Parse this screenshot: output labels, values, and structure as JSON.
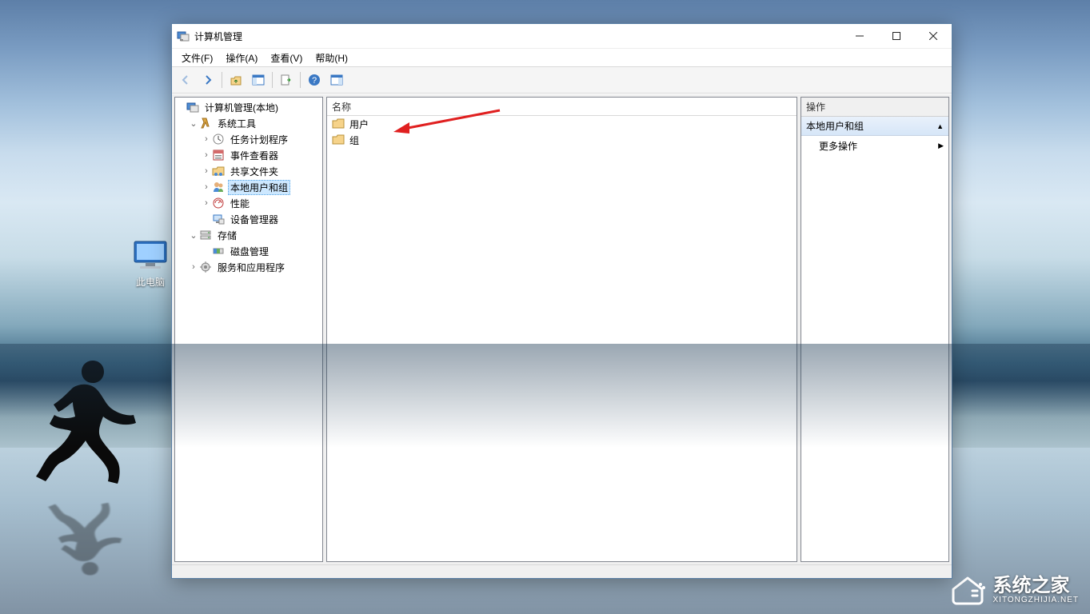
{
  "desktop_icon": {
    "label": "此电脑"
  },
  "watermark": {
    "big": "系统之家",
    "small": "XITONGZHIJIA.NET"
  },
  "window": {
    "title": "计算机管理",
    "menu": {
      "file": "文件(F)",
      "action": "操作(A)",
      "view": "查看(V)",
      "help": "帮助(H)"
    }
  },
  "tree": {
    "root": "计算机管理(本地)",
    "system_tools": "系统工具",
    "task_scheduler": "任务计划程序",
    "event_viewer": "事件查看器",
    "shared_folders": "共享文件夹",
    "local_users_groups": "本地用户和组",
    "performance": "性能",
    "device_manager": "设备管理器",
    "storage": "存储",
    "disk_management": "磁盘管理",
    "services_apps": "服务和应用程序"
  },
  "list": {
    "header_name": "名称",
    "items": [
      {
        "label": "用户"
      },
      {
        "label": "组"
      }
    ]
  },
  "actions": {
    "header": "操作",
    "section": "本地用户和组",
    "more": "更多操作"
  }
}
